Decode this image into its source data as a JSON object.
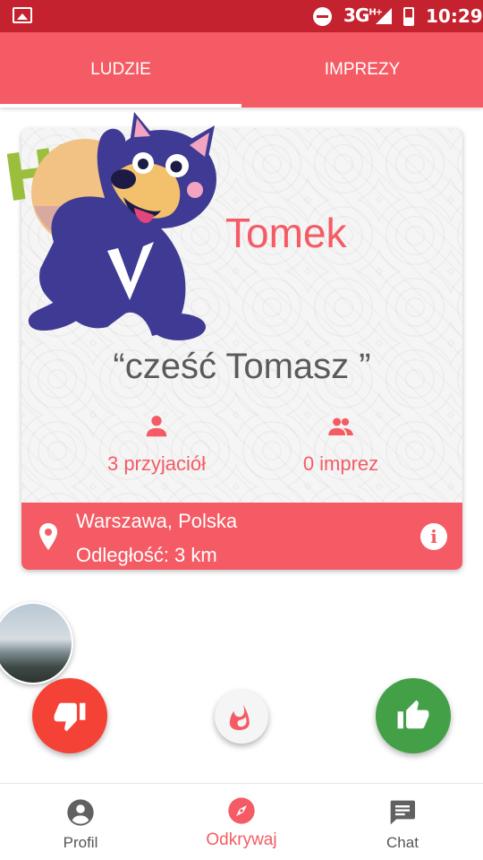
{
  "status_bar": {
    "network": "3G",
    "network_suffix": "H+",
    "time": "10:29",
    "icons": [
      "image-icon",
      "do-not-disturb-icon",
      "signal-icon",
      "battery-icon"
    ]
  },
  "tabs": [
    {
      "label": "LUDZIE",
      "active": true
    },
    {
      "label": "IMPREZY",
      "active": false
    }
  ],
  "card": {
    "mascot_text": "Hi!",
    "name": "Tomek",
    "quote": "“cześć Tomasz ”",
    "friends_label": "3 przyjaciół",
    "events_label": "0 imprez",
    "location": "Warszawa, Polska",
    "distance": "Odległość: 3 km"
  },
  "actions": {
    "dislike_icon": "thumb-down-icon",
    "hot_icon": "flame-icon",
    "like_icon": "thumb-up-icon"
  },
  "bottom_nav": [
    {
      "label": "Profil",
      "icon": "account-circle-icon",
      "active": false
    },
    {
      "label": "Odkrywaj",
      "icon": "compass-icon",
      "active": true
    },
    {
      "label": "Chat",
      "icon": "chat-icon",
      "active": false
    }
  ],
  "colors": {
    "status_bar": "#c5222f",
    "primary": "#f45b64",
    "dislike": "#f44336",
    "like": "#43a047",
    "quote_text": "#5a5a5a"
  }
}
